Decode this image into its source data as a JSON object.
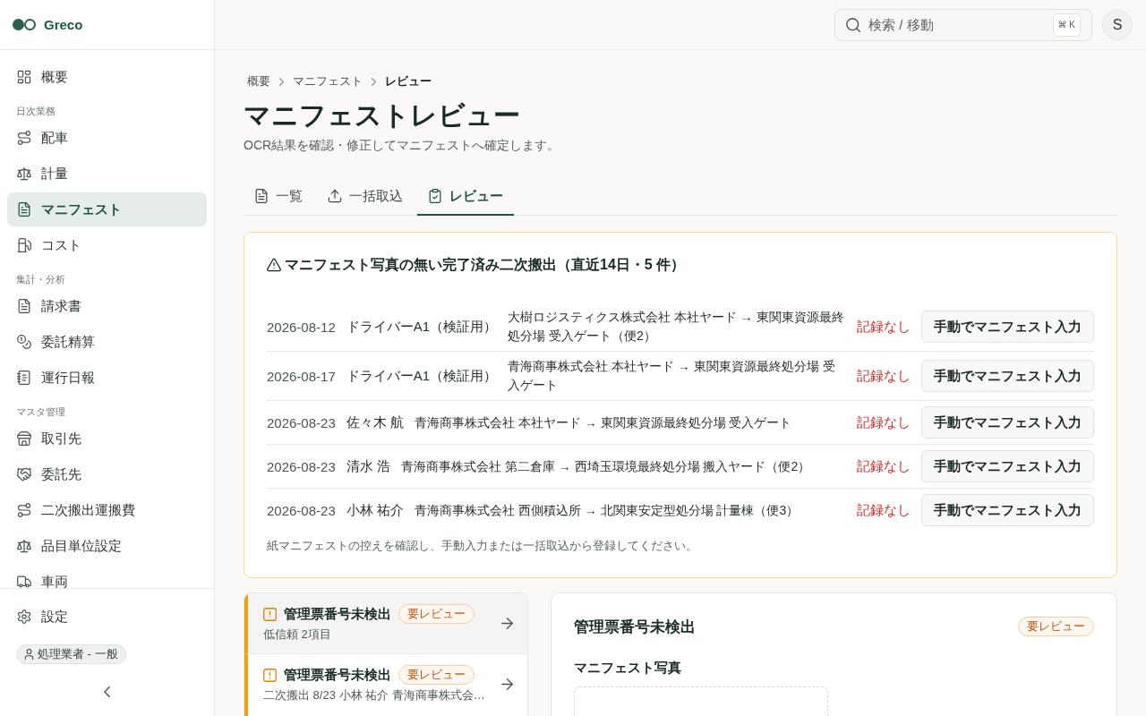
{
  "sidebar": {
    "logo": "Greco",
    "groups": [
      {
        "items": [
          {
            "label": "概要",
            "selected": false
          }
        ]
      },
      {
        "heading": "日次業務",
        "items": [
          {
            "label": "配車",
            "selected": false
          },
          {
            "label": "計量",
            "selected": false
          },
          {
            "label": "マニフェスト",
            "selected": true
          },
          {
            "label": "コスト",
            "selected": false
          }
        ]
      },
      {
        "heading": "集計・分析",
        "items": [
          {
            "label": "請求書",
            "selected": false
          },
          {
            "label": "委託精算",
            "selected": false
          },
          {
            "label": "運行日報",
            "selected": false
          }
        ]
      },
      {
        "heading": "マスタ管理",
        "items": [
          {
            "label": "取引先",
            "selected": false
          },
          {
            "label": "委託先",
            "selected": false
          },
          {
            "label": "二次搬出運搬費",
            "selected": false
          },
          {
            "label": "品目単位設定",
            "selected": false
          },
          {
            "label": "車両",
            "selected": false
          }
        ]
      }
    ],
    "footer": {
      "items": [
        {
          "label": "設定",
          "selected": false
        }
      ],
      "role": "処理業者 - 一般"
    }
  },
  "topbar": {
    "search": {
      "placeholder": "検索 / 移動",
      "shortcut": "⌘ K"
    },
    "avatar": "S"
  },
  "breadcrumb": [
    "概要",
    "マニフェスト",
    "レビュー"
  ],
  "page": {
    "title": "マニフェストレビュー",
    "description": "OCR結果を確認・修正してマニフェストへ確定します。"
  },
  "tabs": [
    {
      "label": "一覧",
      "selected": false
    },
    {
      "label": "一括取込",
      "selected": false
    },
    {
      "label": "レビュー",
      "selected": true
    }
  ],
  "alert": {
    "title": "マニフェスト写真の無い完了済み二次搬出（直近14日・5 件）",
    "rows": [
      {
        "date": "2026-08-12",
        "driver": "ドライバーA1（検証用）",
        "route": "大樹ロジスティクス株式会社 本社ヤード → 東関東資源最終処分場 受入ゲート（便2）",
        "status": "記録なし",
        "action": "手動でマニフェスト入力"
      },
      {
        "date": "2026-08-17",
        "driver": "ドライバーA1（検証用）",
        "route": "青海商事株式会社 本社ヤード → 東関東資源最終処分場 受入ゲート",
        "status": "記録なし",
        "action": "手動でマニフェスト入力"
      },
      {
        "date": "2026-08-23",
        "driver": "佐々木 航",
        "route": "青海商事株式会社 本社ヤード → 東関東資源最終処分場 受入ゲート",
        "status": "記録なし",
        "action": "手動でマニフェスト入力"
      },
      {
        "date": "2026-08-23",
        "driver": "清水 浩",
        "route": "青海商事株式会社 第二倉庫 → 西埼玉環境最終処分場 搬入ヤード（便2）",
        "status": "記録なし",
        "action": "手動でマニフェスト入力"
      },
      {
        "date": "2026-08-23",
        "driver": "小林 祐介",
        "route": "青海商事株式会社 西側積込所 → 北関東安定型処分場 計量棟（便3）",
        "status": "記録なし",
        "action": "手動でマニフェスト入力"
      }
    ],
    "note": "紙マニフェストの控えを確認し、手動入力または一括取込から登録してください。"
  },
  "review_list": {
    "items": [
      {
        "title": "管理票番号未検出",
        "badge": "要レビュー",
        "lines": [
          "低信頼 2項目"
        ],
        "selected": true
      },
      {
        "title": "管理票番号未検出",
        "badge": "要レビュー",
        "lines": [
          "二次搬出 8/23 小林 祐介 青海商事株式会…"
        ],
        "selected": false
      }
    ]
  },
  "review_detail": {
    "title": "管理票番号未検出",
    "badge": "要レビュー",
    "section": "マニフェスト写真"
  }
}
